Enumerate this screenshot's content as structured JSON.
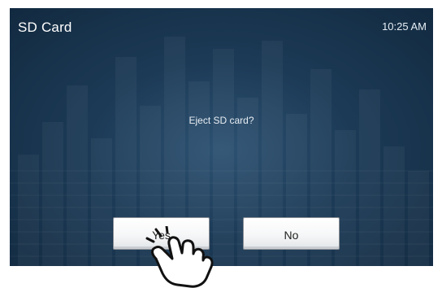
{
  "header": {
    "title": "SD Card",
    "time": "10:25 AM"
  },
  "dialog": {
    "message": "Eject SD card?",
    "yes_label": "Yes",
    "no_label": "No"
  },
  "colors": {
    "background": "#1c3a56",
    "title_text": "#ffffff",
    "button_face": "#f6f7f8"
  },
  "icons": {
    "pointer": "tapping-hand-icon"
  }
}
